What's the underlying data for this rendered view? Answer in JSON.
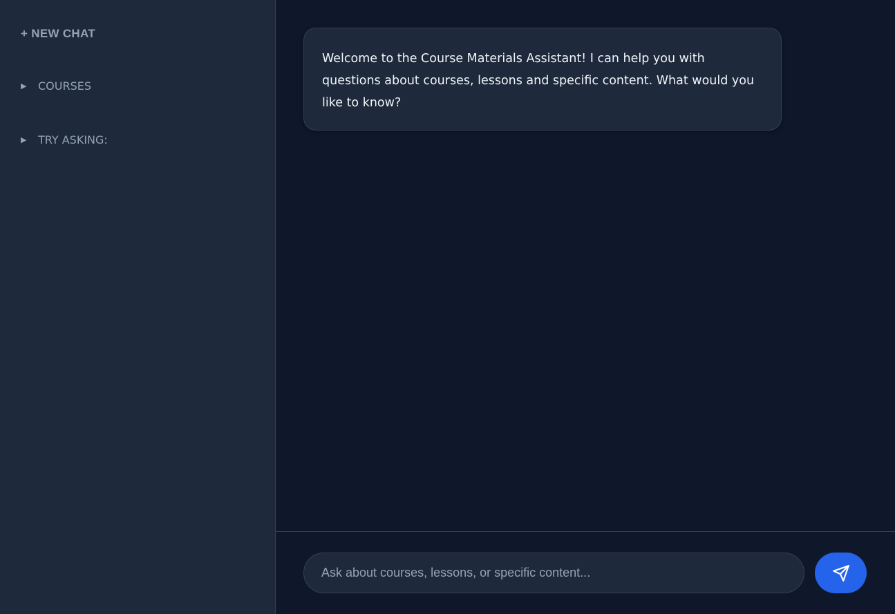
{
  "sidebar": {
    "new_chat_label": "+ NEW CHAT",
    "sections": [
      {
        "label": "COURSES",
        "expanded": false
      },
      {
        "label": "TRY ASKING:",
        "expanded": false
      }
    ],
    "collapsed_glyph": "▶"
  },
  "messages": [
    {
      "role": "assistant",
      "text": "Welcome to the Course Materials Assistant! I can help you with questions about courses, lessons and specific content. What would you like to know?"
    }
  ],
  "input": {
    "value": "",
    "placeholder": "Ask about courses, lessons, or specific content..."
  },
  "send_button": {
    "icon": "send-icon"
  },
  "colors": {
    "background": "#0f172a",
    "surface": "#1e293b",
    "border": "#334155",
    "muted_text": "#94a3b8",
    "text": "#f1f5f9",
    "accent": "#2563eb"
  }
}
